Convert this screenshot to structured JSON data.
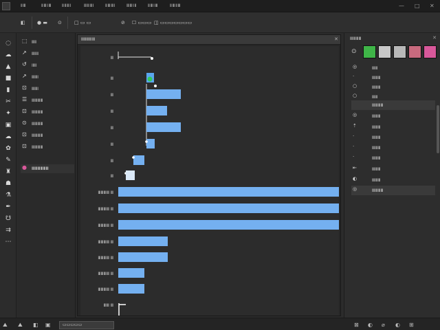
{
  "menubar": {
    "items": [
      "ⅡⅢ",
      "ⅡⅢⅠⅢ",
      "ⅡⅡⅢⅠ",
      "ⅢⅡⅢⅠ",
      "ⅡⅢⅢⅠ",
      "ⅢⅢⅠⅡ",
      "ⅡⅢⅠⅢ",
      "ⅡⅢⅡⅢ"
    ],
    "window_controls": [
      "—",
      "□",
      "✕"
    ]
  },
  "options_bar": {
    "items": [
      "◧",
      "● ▬",
      "⊙",
      "□ ▭ ▭",
      "⊘",
      "☐ ▭▭▭",
      "◫ ▭▭▭▭▭▭▭"
    ]
  },
  "left_panel": {
    "rows": [
      {
        "icon": "⬚",
        "label": "ⅢⅡ"
      },
      {
        "icon": "↗",
        "label": "ⅢⅡⅡ"
      },
      {
        "icon": "↺",
        "label": "ⅠⅢⅠ"
      },
      {
        "icon": "↗",
        "label": "ⅢⅢⅠ"
      },
      {
        "icon": "⊡",
        "label": "ⅢⅢⅠ"
      },
      {
        "icon": "☰",
        "label": "ⅢⅢⅢⅢ"
      },
      {
        "icon": "⊡",
        "label": "ⅢⅢⅢⅢ"
      },
      {
        "icon": "⊙",
        "label": "ⅢⅢⅢⅢ"
      },
      {
        "icon": "⊡",
        "label": "ⅢⅢⅢⅢ"
      },
      {
        "icon": "⊡",
        "label": "ⅢⅢⅢⅢ"
      },
      {
        "icon": "●",
        "label": "ⅢⅢⅢⅢⅢⅢ"
      }
    ]
  },
  "document": {
    "title": "ⅡⅢⅡⅢⅠⅢ",
    "close": "✕"
  },
  "right_panel": {
    "title": "ⅢⅢⅢⅢ",
    "close": "✕",
    "swatch_colors": [
      "#3fb548",
      "#c8c8c8",
      "#b8b8b8",
      "#c86a7e",
      "#d8589a"
    ],
    "rows": [
      {
        "icon": "◎",
        "label": "ⅢⅢ"
      },
      {
        "icon": "·",
        "label": "ⅢⅢⅢ"
      },
      {
        "icon": "○",
        "label": "ⅢⅢⅢ"
      },
      {
        "icon": "○",
        "label": "ⅢⅢ"
      },
      {
        "icon": "",
        "label": "ⅢⅢⅢⅢ"
      },
      {
        "icon": "◎",
        "label": "ⅢⅢⅢ"
      },
      {
        "icon": "⇡",
        "label": "ⅢⅢⅢ"
      },
      {
        "icon": "·",
        "label": "ⅢⅢⅢ"
      },
      {
        "icon": "·",
        "label": "ⅢⅢⅢ"
      },
      {
        "icon": "·",
        "label": "ⅢⅢⅢ"
      },
      {
        "icon": "⇤",
        "label": "ⅢⅢⅢ"
      },
      {
        "icon": "◐",
        "label": "ⅢⅢⅢ"
      },
      {
        "icon": "◎",
        "label": "ⅢⅢⅢⅢ"
      }
    ]
  },
  "status_bar": {
    "items": [
      "⛰",
      "⛰",
      "◧",
      "▭▭▭▭▭",
      "⊠",
      "◐",
      "⌀",
      "◐",
      "⊞"
    ]
  },
  "chart_data": {
    "type": "bar",
    "categories": [
      "Ⅲ",
      "Ⅲ",
      "Ⅲ",
      "Ⅲ",
      "Ⅲ",
      "Ⅲ",
      "Ⅲ",
      "Ⅲ",
      "ⅢⅢⅢⅢ Ⅲ",
      "ⅢⅢⅢⅢ Ⅲ",
      "ⅢⅢⅢⅢ Ⅲ",
      "ⅢⅢⅢⅢ Ⅲ",
      "ⅢⅢⅢⅢ Ⅲ",
      "ⅢⅢⅢⅢ Ⅲ",
      "ⅢⅢⅢⅢ Ⅲ",
      "ⅢⅢ Ⅲ"
    ],
    "starts": [
      0,
      41,
      41,
      41,
      41,
      41,
      22,
      11,
      0,
      0,
      0,
      0,
      0,
      0,
      0,
      0
    ],
    "values": [
      0,
      11,
      50,
      30,
      50,
      12,
      16,
      12,
      322,
      322,
      322,
      72,
      72,
      38,
      38,
      8
    ],
    "bar_color": "#74b0f0",
    "highlight_color": "#33c95a"
  }
}
